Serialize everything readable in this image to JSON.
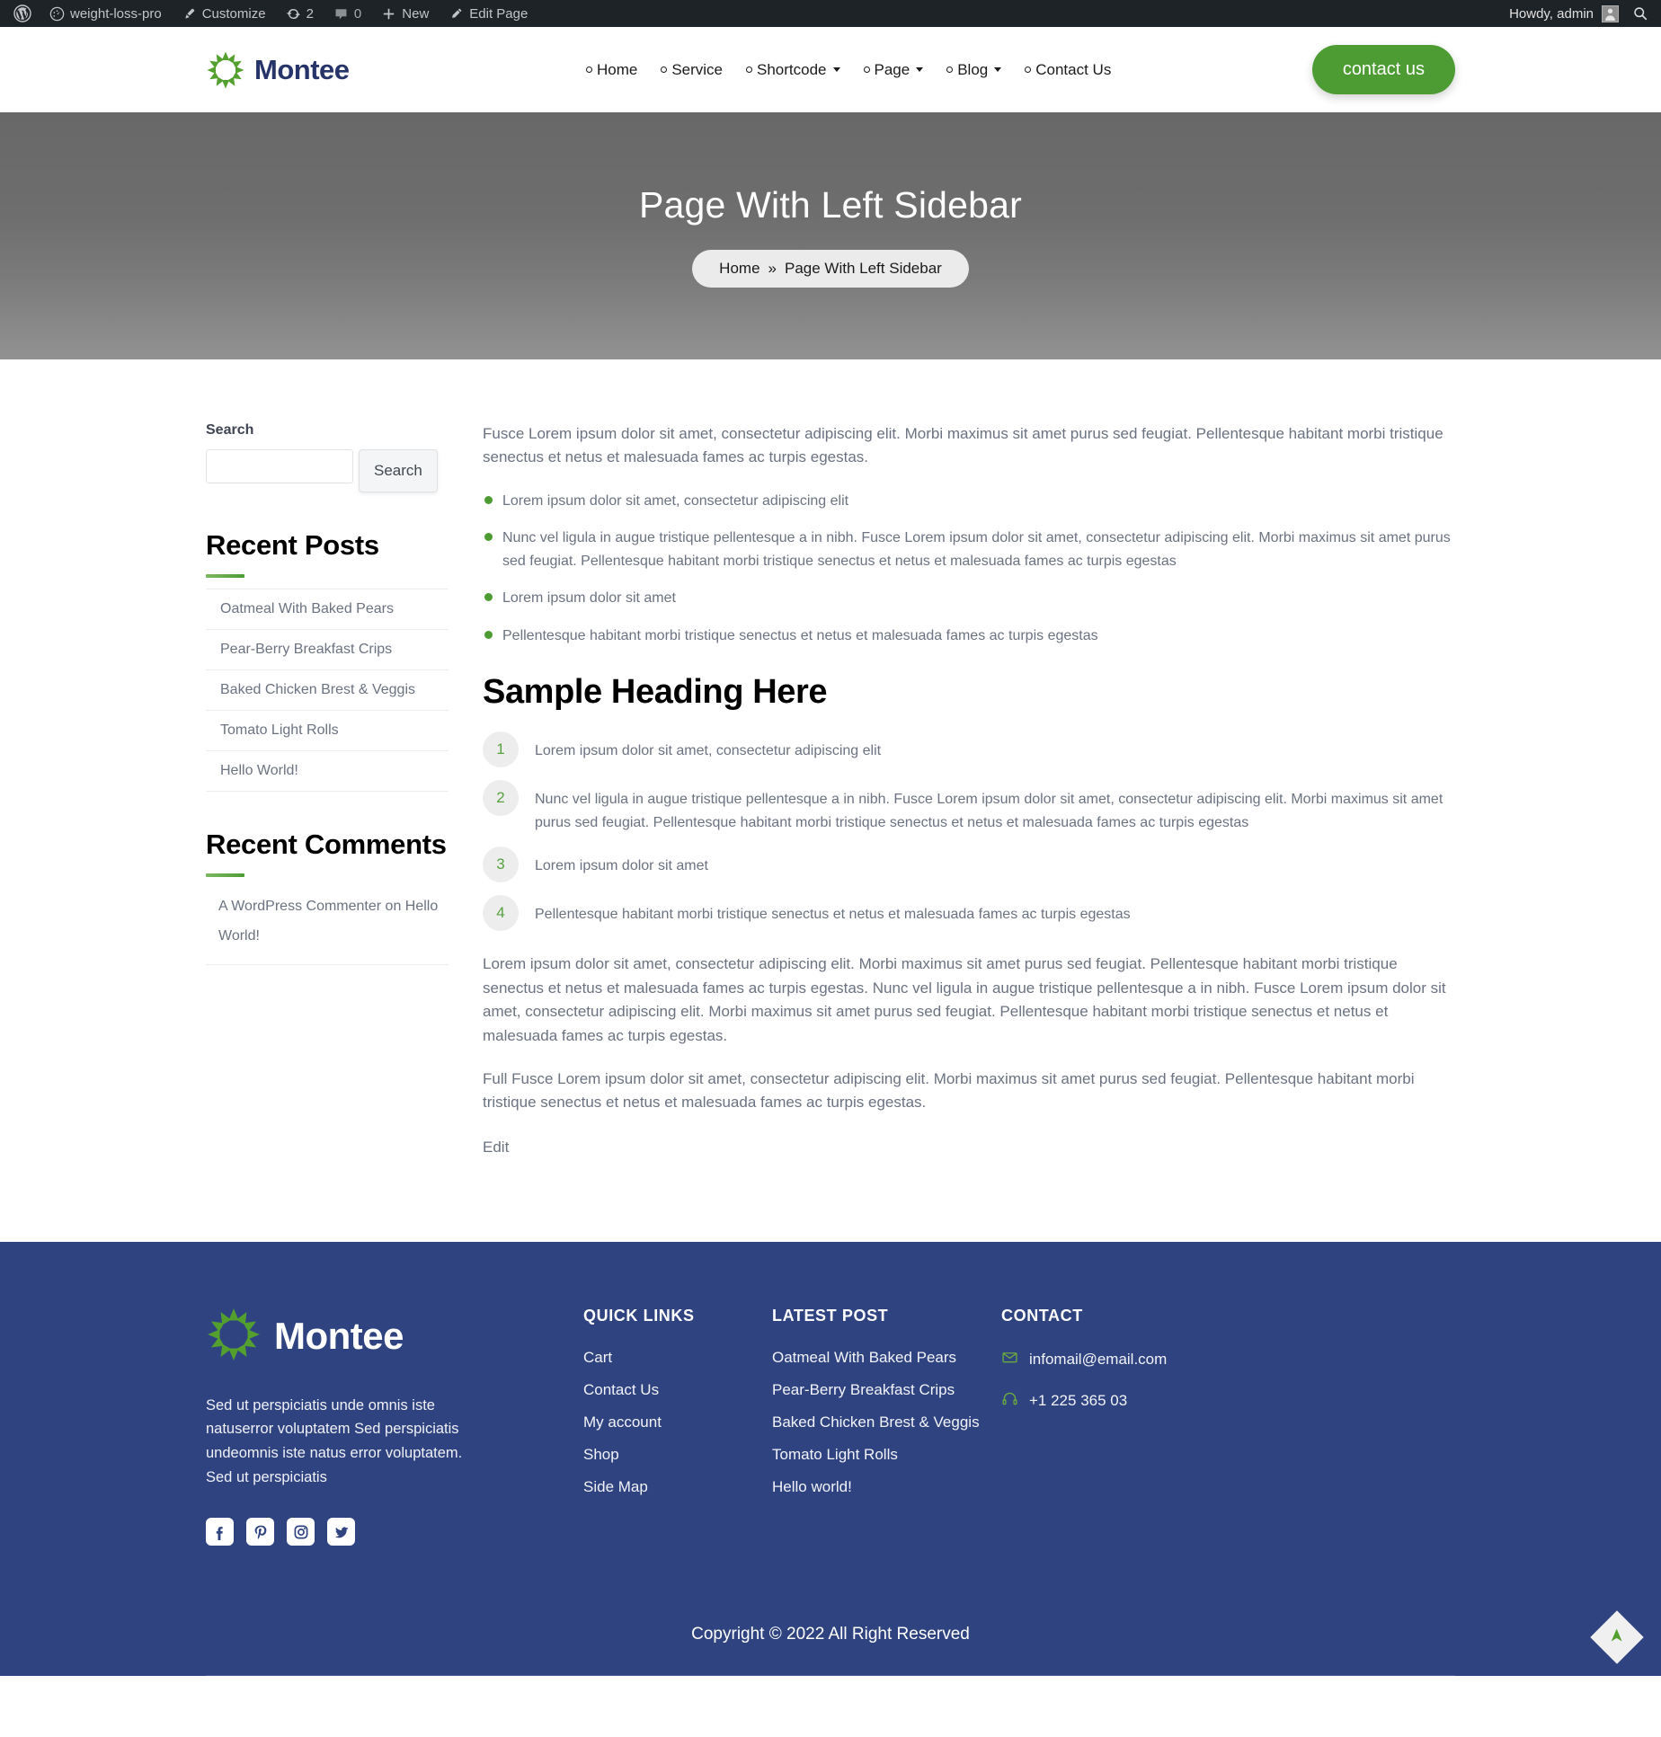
{
  "adminbar": {
    "wp_logo": "wordpress-logo-icon",
    "site_name": "weight-loss-pro",
    "customize": "Customize",
    "updates_count": "2",
    "comments_count": "0",
    "new_label": "New",
    "edit_page": "Edit Page",
    "howdy": "Howdy, admin",
    "search_icon": "search-icon"
  },
  "header": {
    "brand": "Montee",
    "nav": [
      {
        "label": "Home",
        "caret": false
      },
      {
        "label": "Service",
        "caret": false
      },
      {
        "label": "Shortcode",
        "caret": true
      },
      {
        "label": "Page",
        "caret": true
      },
      {
        "label": "Blog",
        "caret": true
      },
      {
        "label": "Contact Us",
        "caret": false
      }
    ],
    "cta": "contact us",
    "cta_color": "#4d9c33"
  },
  "hero": {
    "title": "Page With Left Sidebar",
    "crumb_home": "Home",
    "crumb_sep": "»",
    "crumb_current": "Page With Left Sidebar"
  },
  "sidebar": {
    "search": {
      "label": "Search",
      "value": "",
      "placeholder": "",
      "button": "Search"
    },
    "recent_posts": {
      "title": "Recent Posts",
      "items": [
        "Oatmeal With Baked Pears",
        "Pear-Berry Breakfast Crips",
        "Baked Chicken Brest & Veggis",
        "Tomato Light Rolls",
        "Hello World!"
      ]
    },
    "recent_comments": {
      "title": "Recent Comments",
      "items": [
        "A WordPress Commenter on Hello World!"
      ]
    }
  },
  "content": {
    "intro": "Fusce Lorem ipsum dolor sit amet, consectetur adipiscing elit. Morbi maximus sit amet purus sed feugiat. Pellentesque habitant morbi tristique senectus et netus et malesuada fames ac turpis egestas.",
    "bullets": [
      "Lorem ipsum dolor sit amet, consectetur adipiscing elit",
      "Nunc vel ligula in augue tristique pellentesque a in nibh. Fusce Lorem ipsum dolor sit amet, consectetur adipiscing elit. Morbi maximus sit amet purus sed feugiat. Pellentesque habitant morbi tristique senectus et netus et malesuada fames ac turpis egestas",
      "Lorem ipsum dolor sit amet",
      "Pellentesque habitant morbi tristique senectus et netus et malesuada fames ac turpis egestas"
    ],
    "heading": "Sample Heading Here",
    "numbered": [
      {
        "n": "1",
        "text": "Lorem ipsum dolor sit amet, consectetur adipiscing elit"
      },
      {
        "n": "2",
        "text": "Nunc vel ligula in augue tristique pellentesque a in nibh. Fusce Lorem ipsum dolor sit amet, consectetur adipiscing elit. Morbi maximus sit amet purus sed feugiat. Pellentesque habitant morbi tristique senectus et netus et malesuada fames ac turpis egestas"
      },
      {
        "n": "3",
        "text": "Lorem ipsum dolor sit amet"
      },
      {
        "n": "4",
        "text": "Pellentesque habitant morbi tristique senectus et netus et malesuada fames ac turpis egestas"
      }
    ],
    "para_2": "Lorem ipsum dolor sit amet, consectetur adipiscing elit. Morbi maximus sit amet purus sed feugiat. Pellentesque habitant morbi tristique senectus et netus et malesuada fames ac turpis egestas. Nunc vel ligula in augue tristique pellentesque a in nibh. Fusce Lorem ipsum dolor sit amet, consectetur adipiscing elit. Morbi maximus sit amet purus sed feugiat. Pellentesque habitant morbi tristique senectus et netus et malesuada fames ac turpis egestas.",
    "para_3": "Full Fusce Lorem ipsum dolor sit amet, consectetur adipiscing elit. Morbi maximus sit amet purus sed feugiat. Pellentesque habitant morbi tristique senectus et netus et malesuada fames ac turpis egestas.",
    "edit": "Edit"
  },
  "footer": {
    "brand": "Montee",
    "about": "Sed ut perspiciatis unde omnis iste natuserror voluptatem Sed perspiciatis undeomnis iste natus error voluptatem. Sed ut perspiciatis",
    "socials": [
      "facebook-icon",
      "pinterest-icon",
      "instagram-icon",
      "twitter-icon"
    ],
    "quick_links": {
      "title": "QUICK LINKS",
      "items": [
        "Cart",
        "Contact Us",
        "My account",
        "Shop",
        "Side Map"
      ]
    },
    "latest_post": {
      "title": "LATEST POST",
      "items": [
        "Oatmeal With Baked Pears",
        "Pear-Berry Breakfast Crips",
        "Baked Chicken Brest & Veggis",
        "Tomato Light Rolls",
        "Hello world!"
      ]
    },
    "contact": {
      "title": "CONTACT",
      "email": "infomail@email.com",
      "phone": "+1 225 365 03"
    },
    "copyright": "Copyright © 2022 All Right Reserved",
    "bg_color": "#2f4380",
    "scroll_top_icon": "arrow-up-icon"
  }
}
